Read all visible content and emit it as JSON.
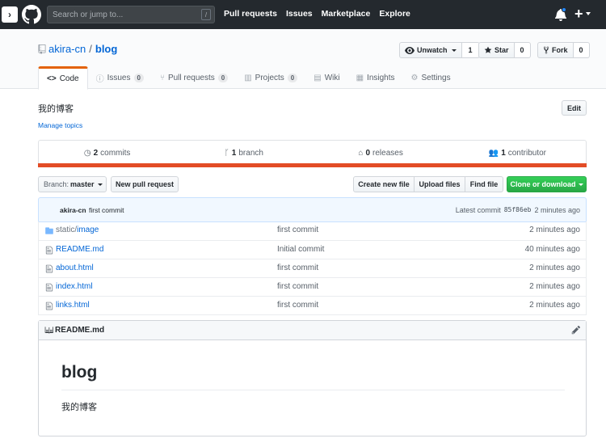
{
  "header": {
    "search_placeholder": "Search or jump to...",
    "search_shortcut": "/",
    "nav": [
      "Pull requests",
      "Issues",
      "Marketplace",
      "Explore"
    ],
    "plus": "+"
  },
  "repo": {
    "owner": "akira-cn",
    "separator": "/",
    "name": "blog",
    "actions": {
      "watch_label": "Unwatch",
      "watch_count": "1",
      "star_label": "Star",
      "star_count": "0",
      "fork_label": "Fork",
      "fork_count": "0"
    },
    "tabs": [
      {
        "label": "Code",
        "icon": "code-icon"
      },
      {
        "label": "Issues",
        "count": "0",
        "icon": "issue-icon"
      },
      {
        "label": "Pull requests",
        "count": "0",
        "icon": "pull-request-icon"
      },
      {
        "label": "Projects",
        "count": "0",
        "icon": "project-icon"
      },
      {
        "label": "Wiki",
        "icon": "book-icon"
      },
      {
        "label": "Insights",
        "icon": "graph-icon"
      },
      {
        "label": "Settings",
        "icon": "gear-icon"
      }
    ]
  },
  "about": {
    "description": "我的博客",
    "manage_topics": "Manage topics",
    "edit_label": "Edit"
  },
  "summary": {
    "commits_num": "2",
    "commits_label": "commits",
    "branches_num": "1",
    "branches_label": "branch",
    "releases_num": "0",
    "releases_label": "releases",
    "contributors_num": "1",
    "contributors_label": "contributor",
    "language_color": "#e34c26"
  },
  "file_nav": {
    "branch_prefix": "Branch:",
    "branch_name": "master",
    "new_pr": "New pull request",
    "create_file": "Create new file",
    "upload_files": "Upload files",
    "find_file": "Find file",
    "clone": "Clone or download"
  },
  "latest_commit": {
    "author": "akira-cn",
    "message": "first commit",
    "label": "Latest commit",
    "sha": "85f86eb",
    "age": "2 minutes ago"
  },
  "files": [
    {
      "type": "dir",
      "dim": "static/",
      "name": "image",
      "message": "first commit",
      "age": "2 minutes ago"
    },
    {
      "type": "file",
      "dim": "",
      "name": "README.md",
      "message": "Initial commit",
      "age": "40 minutes ago"
    },
    {
      "type": "file",
      "dim": "",
      "name": "about.html",
      "message": "first commit",
      "age": "2 minutes ago"
    },
    {
      "type": "file",
      "dim": "",
      "name": "index.html",
      "message": "first commit",
      "age": "2 minutes ago"
    },
    {
      "type": "file",
      "dim": "",
      "name": "links.html",
      "message": "first commit",
      "age": "2 minutes ago"
    }
  ],
  "readme": {
    "filename": "README.md",
    "heading": "blog",
    "body": "我的博客"
  }
}
